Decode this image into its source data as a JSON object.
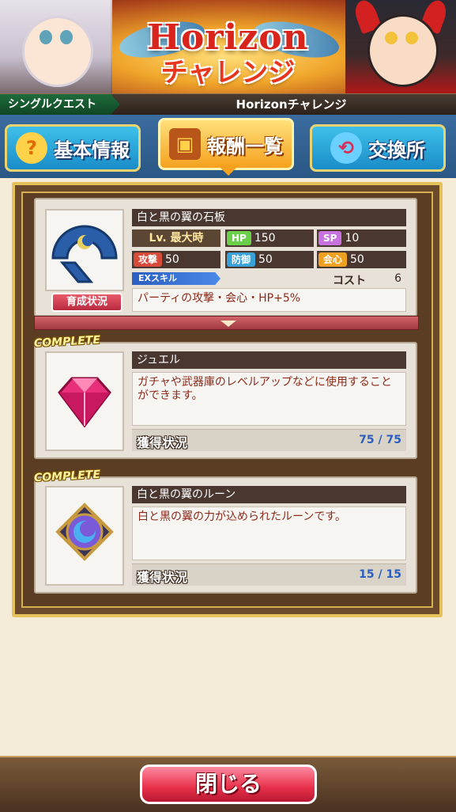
{
  "banner": {
    "title": "Horizon",
    "subtitle": "チャレンジ"
  },
  "quest": {
    "type_label": "シングルクエスト",
    "name": "Horizonチャレンジ"
  },
  "tabs": [
    {
      "label": "基本情報",
      "icon": "question-icon",
      "active": false
    },
    {
      "label": "報酬一覧",
      "icon": "treasure-chest-icon",
      "active": true
    },
    {
      "label": "交換所",
      "icon": "exchange-icon",
      "active": false
    }
  ],
  "rewards": {
    "weapon": {
      "name": "白と黒の翼の石板",
      "level_label": "Lv. 最大時",
      "hp_label": "HP",
      "hp": "150",
      "sp_label": "SP",
      "sp": "10",
      "atk_label": "攻撃",
      "atk": "50",
      "def_label": "防御",
      "def": "50",
      "crit_label": "会心",
      "crit": "50",
      "ex_label": "EXスキル",
      "cost_label": "コスト",
      "cost": "6",
      "skill_desc": "パーティの攻撃・会心・HP+5%",
      "growth_button": "育成状況"
    },
    "items": [
      {
        "badge": "COMPLETE",
        "name": "ジュエル",
        "desc": "ガチャや武器庫のレベルアップなどに使用することができます。",
        "status_label": "獲得状況",
        "count": "75 / 75"
      },
      {
        "badge": "COMPLETE",
        "name": "白と黒の翼のルーン",
        "desc": "白と黒の翼の力が込められたルーンです。",
        "status_label": "獲得状況",
        "count": "15 / 15"
      }
    ]
  },
  "footer": {
    "close_label": "閉じる"
  },
  "colors": {
    "accent_gold": "#e6c25a",
    "close_red": "#e8304a",
    "tab_blue": "#1a8cc8",
    "tab_active": "#f5a11f"
  }
}
